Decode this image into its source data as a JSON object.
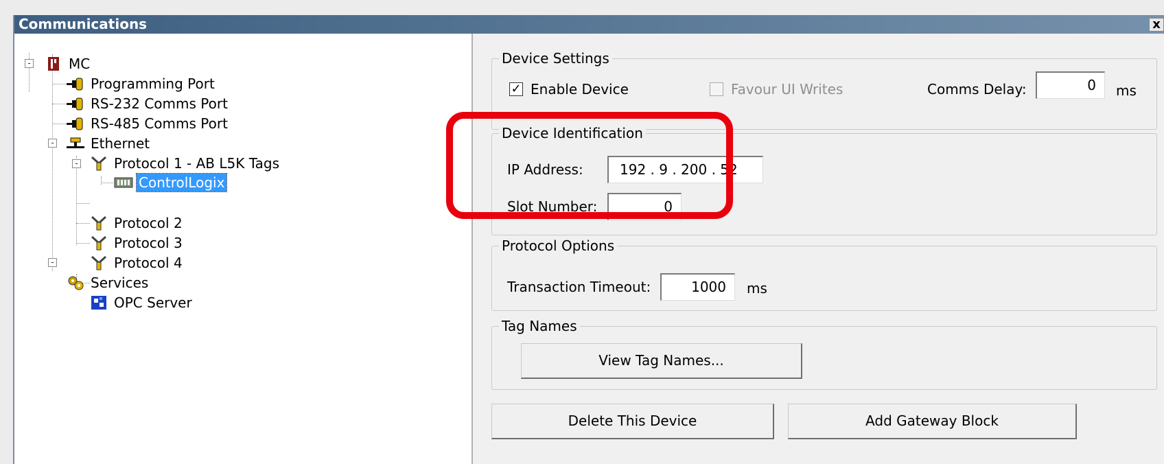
{
  "window": {
    "title": "Communications",
    "close_glyph": "x"
  },
  "tree": {
    "root": "MC",
    "programming_port": "Programming Port",
    "rs232": "RS-232 Comms Port",
    "rs485": "RS-485 Comms Port",
    "ethernet": "Ethernet",
    "protocol1": "Protocol 1 - AB L5K Tags",
    "controllogix": "ControlLogix",
    "protocol2": "Protocol 2",
    "protocol3": "Protocol 3",
    "protocol4": "Protocol 4",
    "services": "Services",
    "opc_server": "OPC Server",
    "expanders": {
      "root": "-",
      "ethernet": "-",
      "protocol1": "-",
      "services": "-"
    }
  },
  "device_settings": {
    "title": "Device Settings",
    "enable_device_label": "Enable Device",
    "enable_device_checked": true,
    "enable_check_glyph": "✓",
    "favour_ui_writes_label": "Favour UI Writes",
    "favour_ui_writes_checked": false,
    "comms_delay_label": "Comms Delay:",
    "comms_delay_value": "0",
    "comms_delay_unit": "ms"
  },
  "device_identification": {
    "title": "Device Identification",
    "ip_address_label": "IP Address:",
    "ip_address_value": "192 . 9 . 200 . 52",
    "slot_number_label": "Slot Number:",
    "slot_number_value": "0"
  },
  "protocol_options": {
    "title": "Protocol Options",
    "transaction_timeout_label": "Transaction Timeout:",
    "transaction_timeout_value": "1000",
    "transaction_timeout_unit": "ms"
  },
  "tag_names": {
    "title": "Tag Names",
    "view_button": "View Tag Names..."
  },
  "actions": {
    "delete_button": "Delete This Device",
    "add_gateway_button": "Add Gateway Block"
  },
  "colors": {
    "highlight": "#e8000d",
    "selection": "#3399ff",
    "titlebar": "#3d5e80"
  }
}
